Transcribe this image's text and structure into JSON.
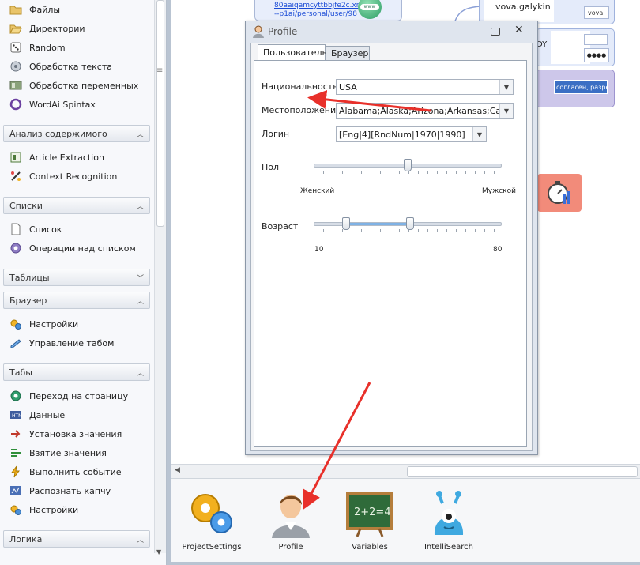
{
  "sidebar": {
    "top_items": [
      {
        "label": "Файлы",
        "icon": "folder-icon"
      },
      {
        "label": "Директории",
        "icon": "folder-open-icon"
      },
      {
        "label": "Random",
        "icon": "dice-icon"
      },
      {
        "label": "Обработка текста",
        "icon": "text-processing-icon"
      },
      {
        "label": "Обработка переменных",
        "icon": "variables-processing-icon"
      },
      {
        "label": "WordAi Spintax",
        "icon": "wordai-icon"
      }
    ],
    "sections": {
      "analysis": {
        "title": "Анализ содержимого",
        "items": [
          "Article Extraction",
          "Context Recognition"
        ]
      },
      "lists": {
        "title": "Списки",
        "items": [
          "Список",
          "Операции над списком"
        ]
      },
      "tables": {
        "title": "Таблицы"
      },
      "browser": {
        "title": "Браузер",
        "items": [
          "Настройки",
          "Управление табом"
        ]
      },
      "tabs": {
        "title": "Табы",
        "items": [
          "Переход на страницу",
          "Данные",
          "Установка значения",
          "Взятие значения",
          "Выполнить событие",
          "Распознать капчу",
          "Настройки"
        ]
      },
      "logic": {
        "title": "Логика"
      }
    }
  },
  "canvas": {
    "link_text_1": "80aaiqamcyttbbjfe2c.xn",
    "link_text_2": "--p1ai/personal/user/98",
    "node_vova": "vova.galykin",
    "node_small_1": "vova.",
    "node_dy": "DY",
    "node_dots": "●●●●",
    "node_banner": "согласен, разреше"
  },
  "dialog": {
    "title": "Profile",
    "tabs": [
      "Пользователь",
      "Браузер"
    ],
    "nationality_label": "Национальность",
    "nationality_value": "USA",
    "location_label": "Местоположение",
    "location_value": "Alabama;Alaska;Arizona;Arkansas;Calif…",
    "login_label": "Логин",
    "login_value": "[Eng|4][RndNum|1970|1990]",
    "gender_label": "Пол",
    "gender_left": "Женский",
    "gender_right": "Мужской",
    "gender_slider_fraction": 0.5,
    "age_label": "Возраст",
    "age_min": "10",
    "age_max": "80",
    "age_range_values": [
      22,
      46
    ]
  },
  "toolbar": {
    "items": [
      "ProjectSettings",
      "Profile",
      "Variables",
      "IntelliSearch"
    ],
    "chalkboard_text": "2+2=4"
  },
  "colors": {
    "annotation_arrow": "#e8302a",
    "banner_blue": "#3b6fc4",
    "timer_tile": "#f28b7a"
  }
}
